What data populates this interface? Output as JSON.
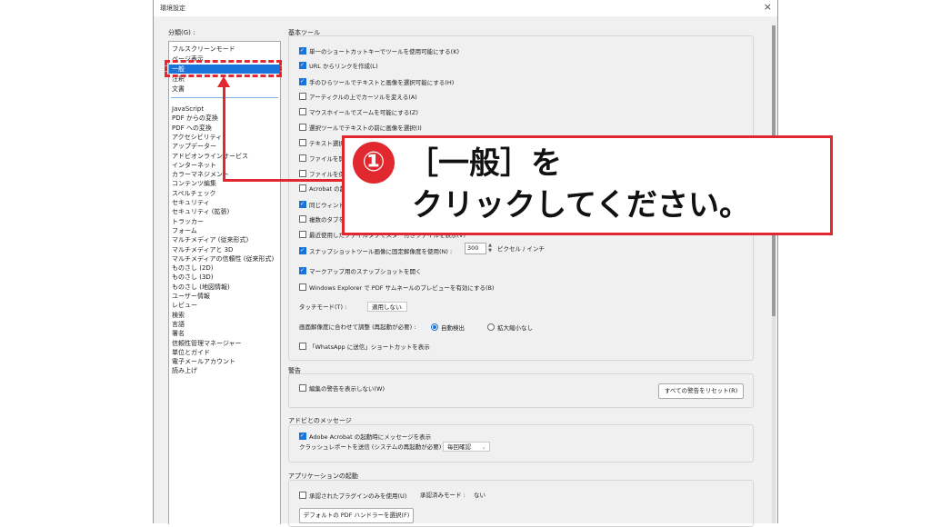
{
  "dialog": {
    "title": "環境設定",
    "close_glyph": "×"
  },
  "categories": {
    "label": "分類(G) :",
    "top_items": [
      "フルスクリーンモード",
      "ページ表示",
      "一般",
      "注釈",
      "文書"
    ],
    "selected": "一般",
    "items": [
      "JavaScript",
      "PDF からの変換",
      "PDF への変換",
      "アクセシビリティ",
      "アップデーター",
      "アドビオンラインサービス",
      "インターネット",
      "カラーマネジメント",
      "コンテンツ編集",
      "スペルチェック",
      "セキュリティ",
      "セキュリティ (拡張)",
      "トラッカー",
      "フォーム",
      "マルチメディア (従来形式)",
      "マルチメディアと 3D",
      "マルチメディアの信頼性 (従来形式)",
      "ものさし (2D)",
      "ものさし (3D)",
      "ものさし (地図情報)",
      "ユーザー情報",
      "レビュー",
      "検索",
      "言語",
      "署名",
      "信頼性管理マネージャー",
      "単位とガイド",
      "電子メールアカウント",
      "読み上げ"
    ]
  },
  "basic_tools": {
    "title": "基本ツール",
    "options": [
      {
        "label": "単一のショートカットキーでツールを使用可能にする(K)",
        "checked": true
      },
      {
        "label": "URL からリンクを作成(L)",
        "checked": true
      },
      {
        "label": "手のひらツールでテキストと画像を選択可能にする(H)",
        "checked": true
      },
      {
        "label": "アーティクルの上でカーソルを変える(A)",
        "checked": false
      },
      {
        "label": "マウスホイールでズームを可能にする(Z)",
        "checked": false
      },
      {
        "label": "選択ツールでテキストの前に画像を選択(I)",
        "checked": false
      },
      {
        "label": "テキスト選択",
        "checked": false
      },
      {
        "label": "ファイルを開く",
        "checked": false
      },
      {
        "label": "ファイルを保存",
        "checked": false
      },
      {
        "label": "Acrobat の起",
        "checked": false
      },
      {
        "label": "同じウィンドウ",
        "checked": true
      },
      {
        "label": "複数のタブを",
        "checked": false
      },
      {
        "label": "最近使用したファイルタブでスター付きファイルを表示(V)",
        "checked": false
      },
      {
        "label": "スナップショットツール画像に固定解像度を使用(N) :",
        "checked": true
      },
      {
        "label": "マークアップ用のスナップショットを開く",
        "checked": true
      },
      {
        "label": "Windows Explorer で PDF サムネールのプレビューを有効にする(B)",
        "checked": false
      }
    ],
    "snapshot_value": "300",
    "snapshot_unit": "ピクセル / インチ",
    "touch_mode_label": "タッチモード(T) :",
    "touch_mode_value": "適用しない",
    "resolution_label": "画面解像度に合わせて調整 (再起動が必要) :",
    "resolution_auto": "自動検出",
    "resolution_none": "拡大縮小なし",
    "whatsapp": {
      "label": "「WhatsApp に送信」ショートカットを表示",
      "checked": false
    }
  },
  "warnings": {
    "title": "警告",
    "option": {
      "label": "編集の警告を表示しない(W)",
      "checked": false
    },
    "reset_button": "すべての警告をリセット(R)"
  },
  "adobe_messages": {
    "title": "アドビとのメッセージ",
    "option": {
      "label": "Adobe Acrobat の起動時にメッセージを表示",
      "checked": true
    },
    "crash_label": "クラッシュレポートを送信 (システムの再起動が必要) :",
    "crash_value": "毎回確認"
  },
  "app_startup": {
    "title": "アプリケーションの起動",
    "option": {
      "label": "承認されたプラグインのみを使用(U)",
      "checked": false
    },
    "approved_mode_label": "承認済みモード :",
    "approved_mode_value": "ない",
    "default_pdf_button": "デフォルトの PDF ハンドラーを選択(F)"
  },
  "callout": {
    "number": "①",
    "line1": "［一般］を",
    "line2": "クリックしてください。"
  },
  "colors": {
    "accent": "#e0282e",
    "selection": "#1a73d9"
  }
}
